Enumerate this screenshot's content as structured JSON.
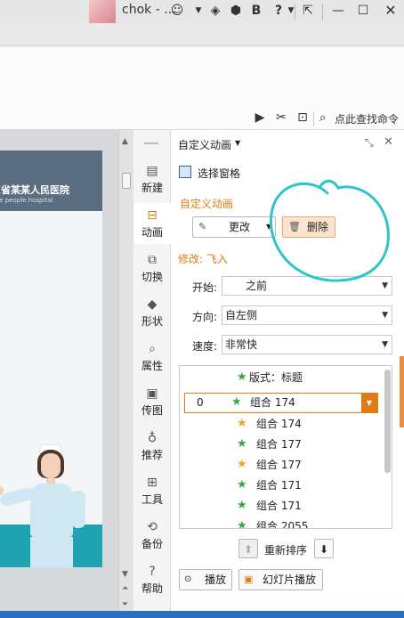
{
  "titlebar": {
    "user_name": "chok - ...",
    "icons": [
      "avatar-icon",
      "emoji-icon",
      "chevron-down-icon",
      "cube-icon",
      "skin-icon",
      "bold-icon",
      "help-icon",
      "exit-fullscreen-icon",
      "minimize-icon",
      "maximize-icon",
      "close-icon"
    ],
    "help_glyph": "?"
  },
  "toolband": {
    "search_command": "点此查找命令"
  },
  "slide": {
    "hospital_name": "XX省某某人民医院",
    "hospital_en": "the people hospital"
  },
  "nav": {
    "items": [
      {
        "label": "新建",
        "icon": "new-icon"
      },
      {
        "label": "动画",
        "icon": "animation-icon"
      },
      {
        "label": "切换",
        "icon": "transition-icon"
      },
      {
        "label": "形状",
        "icon": "shapes-icon"
      },
      {
        "label": "属性",
        "icon": "properties-icon"
      },
      {
        "label": "传图",
        "icon": "upload-image-icon"
      },
      {
        "label": "推荐",
        "icon": "recommend-icon"
      },
      {
        "label": "工具",
        "icon": "toolbox-icon"
      },
      {
        "label": "备份",
        "icon": "backup-icon"
      },
      {
        "label": "帮助",
        "icon": "help-icon"
      }
    ]
  },
  "panel": {
    "title": "自定义动画",
    "select_pane": "选择窗格",
    "section_title": "自定义动画",
    "change_label": "更改",
    "delete_label": "删除",
    "modify_label": "修改: 飞入",
    "start_label": "开始:",
    "start_value": "之前",
    "direction_label": "方向:",
    "direction_value": "自左侧",
    "speed_label": "速度:",
    "speed_value": "非常快",
    "list": [
      {
        "index": "",
        "label": "版式：标题",
        "star": "green"
      },
      {
        "index": "0",
        "label": "组合 174",
        "star": "green"
      },
      {
        "index": "",
        "label": "组合 174",
        "star": "orange"
      },
      {
        "index": "",
        "label": "组合 177",
        "star": "green"
      },
      {
        "index": "",
        "label": "组合 177",
        "star": "orange"
      },
      {
        "index": "",
        "label": "组合 171",
        "star": "green"
      },
      {
        "index": "",
        "label": "组合 171",
        "star": "green"
      },
      {
        "index": "",
        "label": "组合 2055",
        "star": "green"
      }
    ],
    "reorder_label": "重新排序",
    "play_label": "播放",
    "slideshow_label": "幻灯片播放"
  },
  "colors": {
    "accent_orange": "#e07b16",
    "annotation_cyan": "#2ec4c9",
    "star_green": "#3aa64a",
    "star_orange": "#f2a12e"
  }
}
